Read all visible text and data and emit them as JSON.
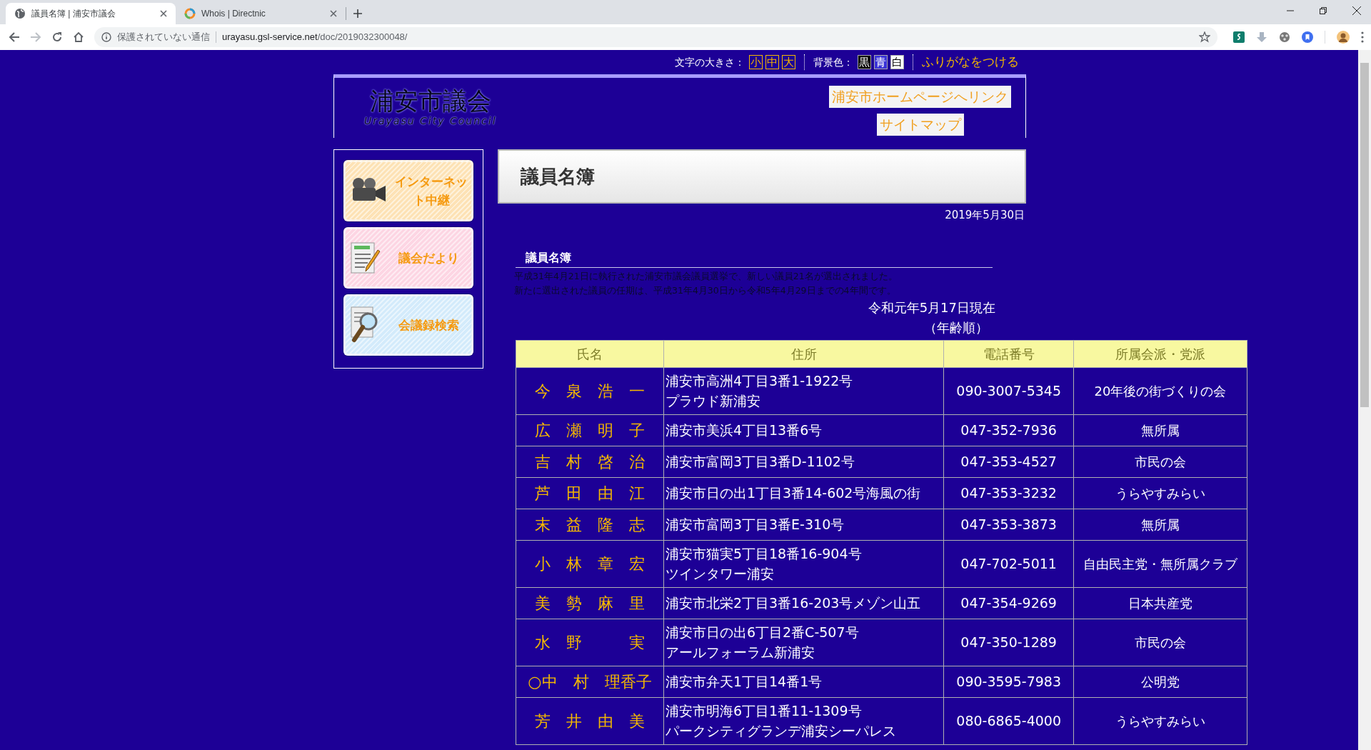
{
  "browser": {
    "tabs": [
      {
        "title": "議員名簿 | 浦安市議会",
        "selected": true,
        "kind": "globe"
      },
      {
        "title": "Whois | Directnic",
        "selected": false,
        "kind": "ring"
      }
    ],
    "security": "保護されていない通信",
    "url_host": "urayasu.gsl-service.net",
    "url_path": "/doc/2019032300048/"
  },
  "toolbar": {
    "font_size_label": "文字の大きさ：",
    "font_sizes": [
      "小",
      "中",
      "大"
    ],
    "bg_label": "背景色：",
    "bg_colors": [
      {
        "label": "黒",
        "color": "#000000"
      },
      {
        "label": "青",
        "color": "#3b34d8"
      },
      {
        "label": "白",
        "color": "#ffffff"
      }
    ],
    "furigana": "ふりがなをつける"
  },
  "header": {
    "logo": "浦安市議会",
    "logo_sub": "Urayasu City Council",
    "links": [
      "浦安市ホームページへリンク",
      "サイトマップ"
    ]
  },
  "sidebar": [
    {
      "label": "インターネット中継",
      "kind": "camera",
      "color": "#fde2b5"
    },
    {
      "label": "議会だより",
      "kind": "notepad",
      "color": "#fdd5e3"
    },
    {
      "label": "会議録検索",
      "kind": "magnifier",
      "color": "#d3ebfb"
    }
  ],
  "page": {
    "title": "議員名簿",
    "date": "2019年5月30日",
    "section_heading": "議員名簿",
    "intro": [
      "平成31年4月21日に執行された浦安市議会議員選挙で、新しい議員21名が選出されました。",
      "新たに選出された議員の任期は、平成31年4月30日から令和5年4月29日までの4年間です。"
    ],
    "as_of": "令和元年5月17日現在",
    "order": "（年齢順）"
  },
  "table": {
    "columns": [
      "氏名",
      "住所",
      "電話番号",
      "所属会派・党派"
    ],
    "rows": [
      {
        "name": "今　泉　浩　一",
        "address": [
          "浦安市高洲4丁目3番1-1922号",
          "プラウド新浦安"
        ],
        "phone": "090-3007-5345",
        "faction": "20年後の街づくりの会"
      },
      {
        "name": "広　瀬　明　子",
        "address": [
          "浦安市美浜4丁目13番6号"
        ],
        "phone": "047-352-7936",
        "faction": "無所属"
      },
      {
        "name": "吉　村　啓　治",
        "address": [
          "浦安市富岡3丁目3番D-1102号"
        ],
        "phone": "047-353-4527",
        "faction": "市民の会"
      },
      {
        "name": "芦　田　由　江",
        "address": [
          "浦安市日の出1丁目3番14-602号海風の街"
        ],
        "phone": "047-353-3232",
        "faction": "うらやすみらい"
      },
      {
        "name": "末　益　隆　志",
        "address": [
          "浦安市富岡3丁目3番E-310号"
        ],
        "phone": "047-353-3873",
        "faction": "無所属"
      },
      {
        "name": "小　林　章　宏",
        "address": [
          "浦安市猫実5丁目18番16-904号",
          "ツインタワー浦安"
        ],
        "phone": "047-702-5011",
        "faction": "自由民主党・無所属クラブ"
      },
      {
        "name": "美　勢　麻　里",
        "address": [
          "浦安市北栄2丁目3番16-203号メゾン山五"
        ],
        "phone": "047-354-9269",
        "faction": "日本共産党"
      },
      {
        "name": "水　野　　　実",
        "address": [
          "浦安市日の出6丁目2番C-507号",
          "アールフォーラム新浦安"
        ],
        "phone": "047-350-1289",
        "faction": "市民の会"
      },
      {
        "name": "○中　村　理香子",
        "address": [
          "浦安市弁天1丁目14番1号"
        ],
        "phone": "090-3595-7983",
        "faction": "公明党"
      },
      {
        "name": "芳　井　由　美",
        "address": [
          "浦安市明海6丁目1番11-1309号",
          "パークシティグランデ浦安シーパレス"
        ],
        "phone": "080-6865-4000",
        "faction": "うらやすみらい"
      }
    ]
  }
}
